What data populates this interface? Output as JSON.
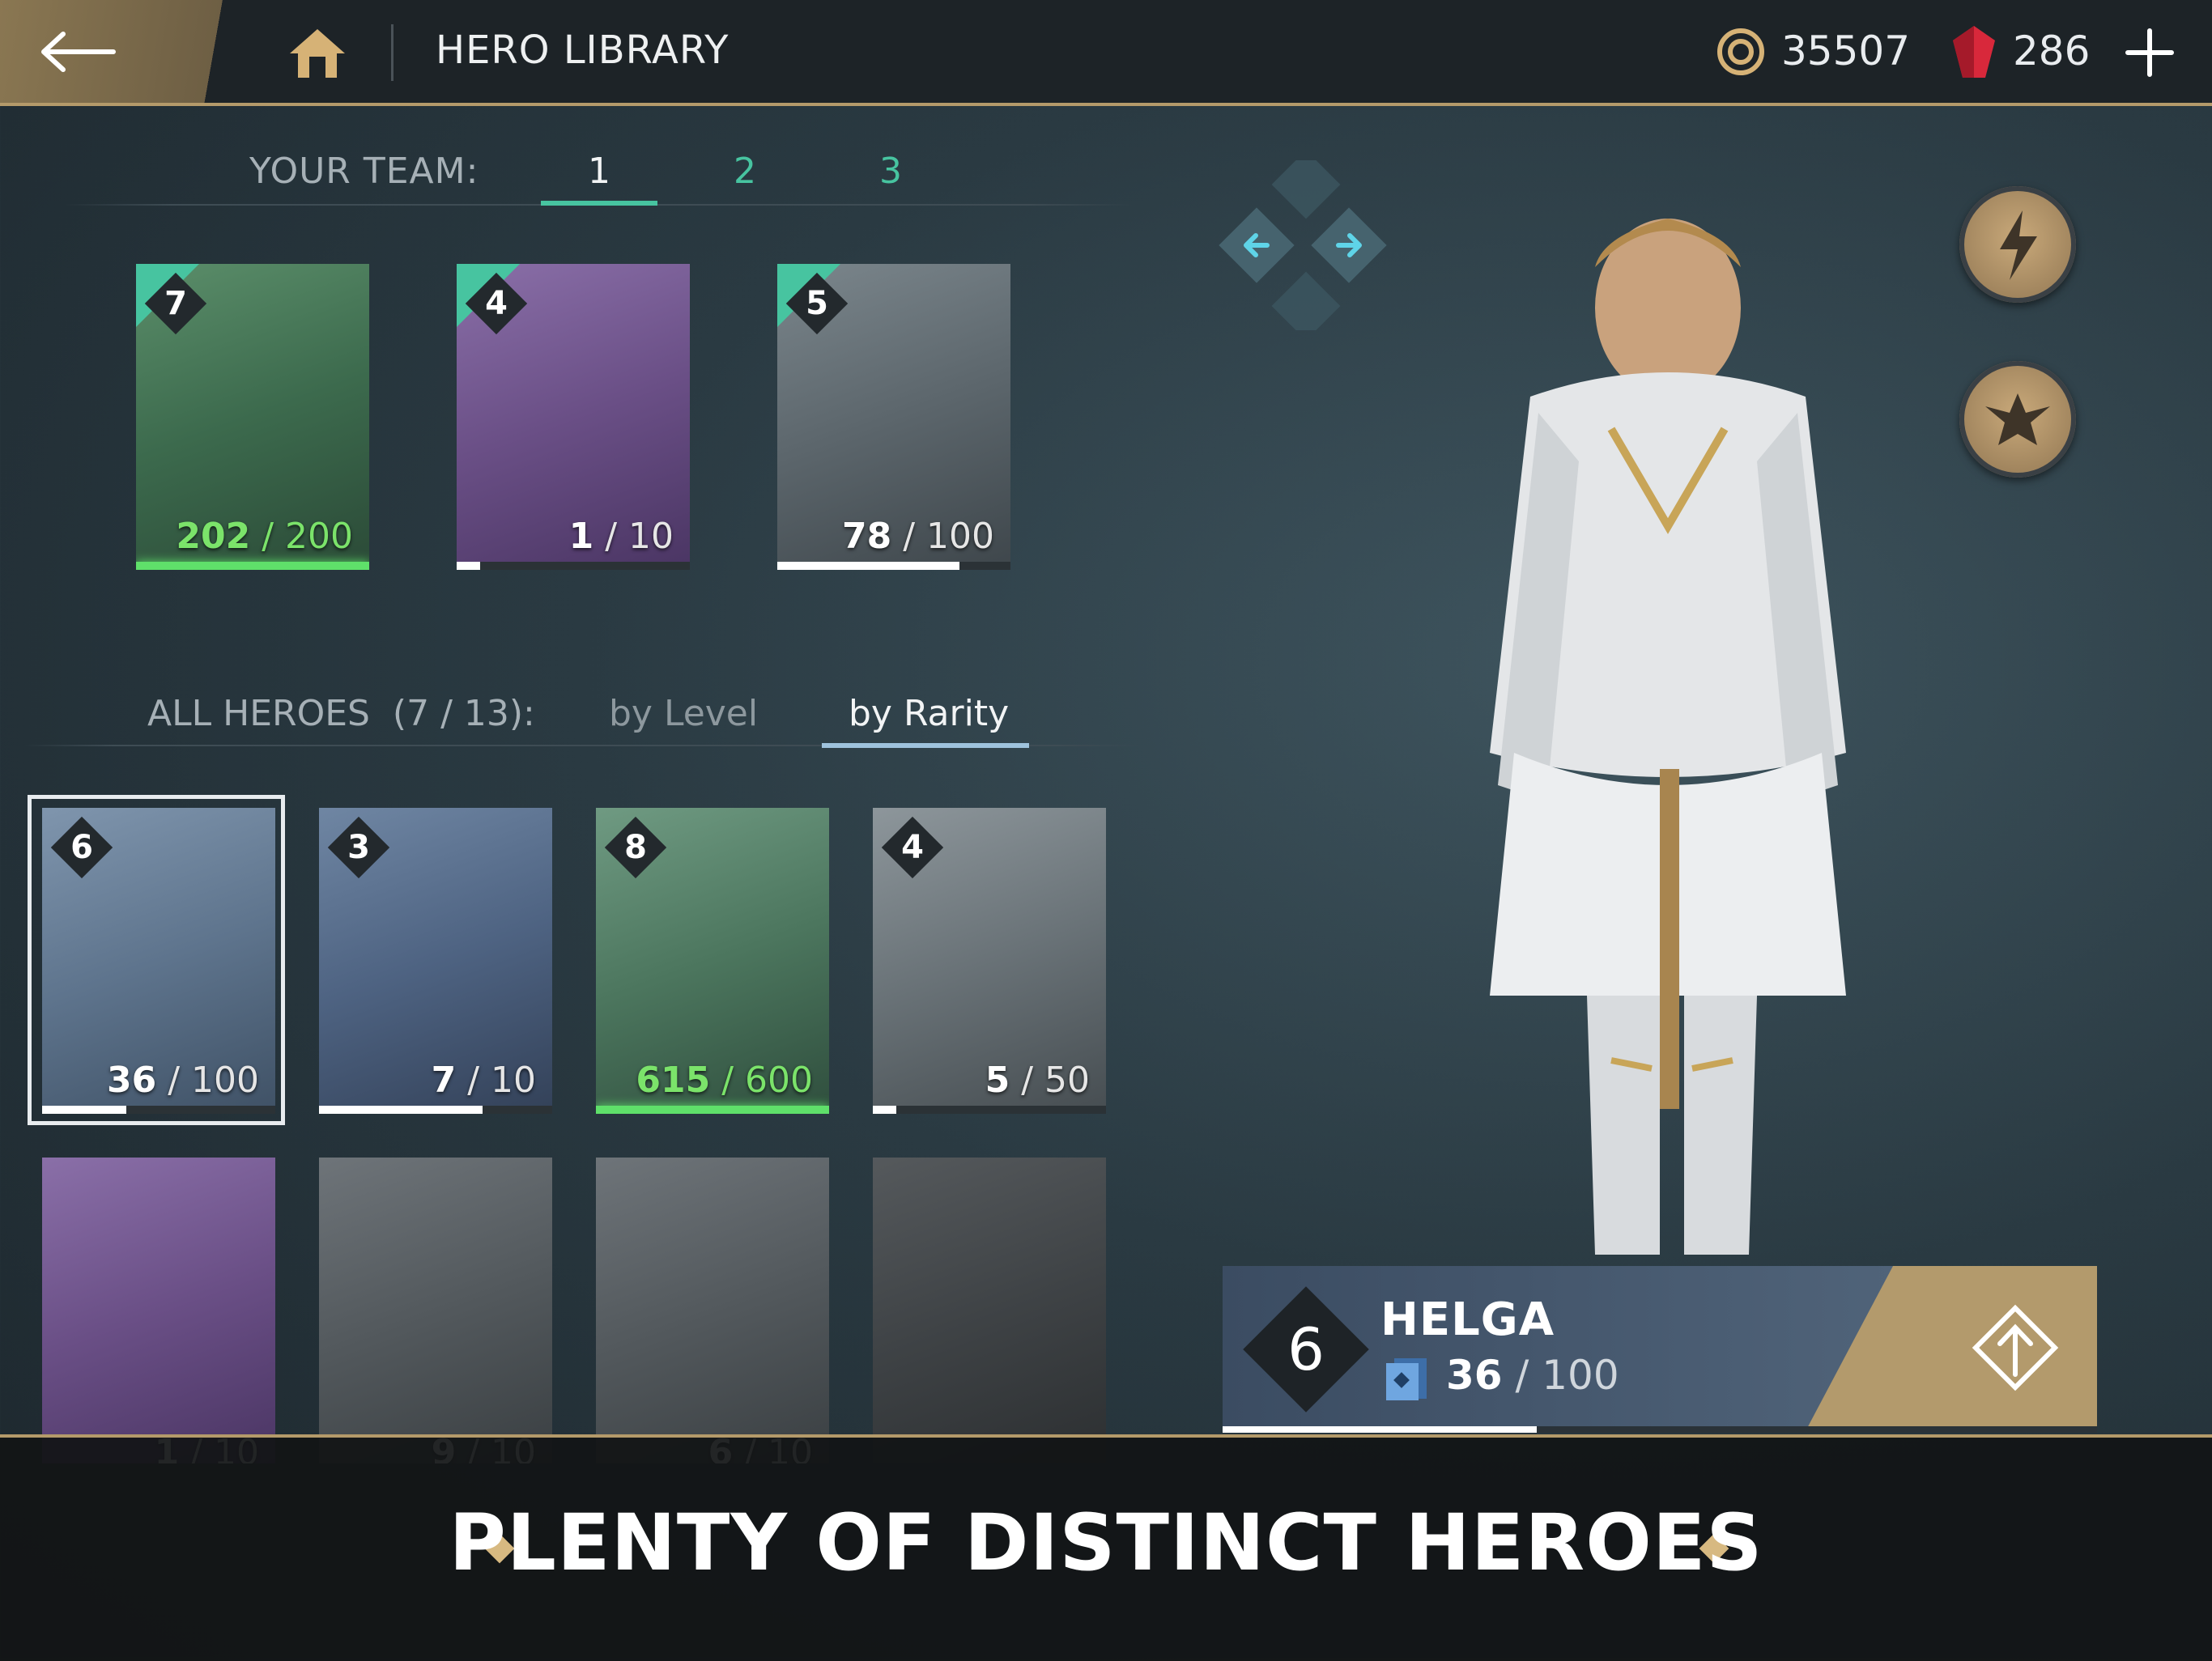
{
  "header": {
    "title": "HERO LIBRARY",
    "coins": "35507",
    "gems": "286"
  },
  "team": {
    "label": "YOUR TEAM:",
    "tabs": [
      "1",
      "2",
      "3"
    ],
    "active_tab": 0,
    "cards": [
      {
        "level": "7",
        "progress": "202",
        "max": "200",
        "fill": 1.0,
        "style": "green"
      },
      {
        "level": "4",
        "progress": "1",
        "max": "10",
        "fill": 0.1,
        "style": "purple"
      },
      {
        "level": "5",
        "progress": "78",
        "max": "100",
        "fill": 0.78,
        "style": "grey"
      }
    ]
  },
  "heroes": {
    "label": "ALL HEROES",
    "count": "(7 / 13):",
    "sort_level": "by Level",
    "sort_rarity": "by Rarity",
    "grid_row1": [
      {
        "level": "6",
        "progress": "36",
        "max": "100",
        "fill": 0.36,
        "style": "blue"
      },
      {
        "level": "3",
        "progress": "7",
        "max": "10",
        "fill": 0.7,
        "style": "blue"
      },
      {
        "level": "8",
        "progress": "615",
        "max": "600",
        "fill": 1.0,
        "style": "green"
      },
      {
        "level": "4",
        "progress": "5",
        "max": "50",
        "fill": 0.1,
        "style": "grey"
      }
    ],
    "grid_row2": [
      {
        "progress": "1",
        "max": "10",
        "style": "purple"
      },
      {
        "progress": "9",
        "max": "10",
        "style": "locked"
      },
      {
        "progress": "6",
        "max": "10",
        "style": "locked"
      },
      {
        "progress": "",
        "max": "",
        "style": "locked-dark"
      }
    ]
  },
  "selected_hero": {
    "level": "6",
    "name": "HELGA",
    "progress": "36",
    "max": "100",
    "fill": 0.36
  },
  "banner": {
    "text": "PLENTY OF DISTINCT HEROES"
  },
  "colors": {
    "accent_green": "#47c4a0",
    "gold": "#b49a6a",
    "progress_green": "#5fe06a"
  }
}
